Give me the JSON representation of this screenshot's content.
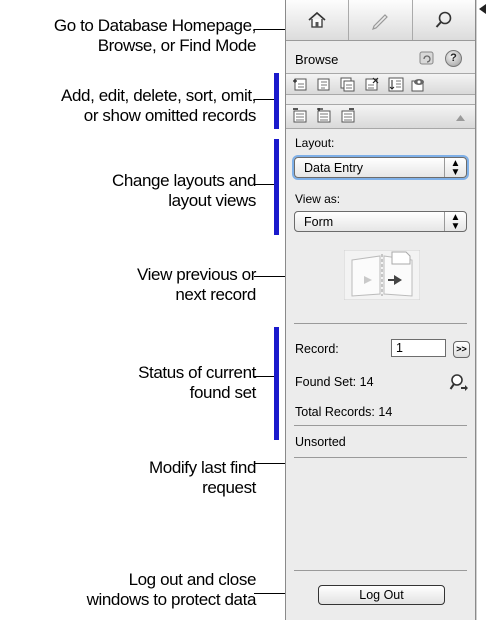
{
  "callouts": {
    "modes": [
      "Go to Database Homepage,",
      "Browse, or Find Mode"
    ],
    "records": [
      "Add, edit, delete, sort, omit,",
      "or show omitted records"
    ],
    "layouts": [
      "Change layouts and",
      "layout views"
    ],
    "navigate": [
      "View previous or",
      "next record"
    ],
    "status": [
      "Status of current",
      "found set"
    ],
    "modify": [
      "Modify last find",
      "request"
    ],
    "logout": [
      "Log out and close",
      "windows to protect data"
    ]
  },
  "panel": {
    "mode_header": "Browse",
    "help_glyph": "?",
    "layout_label": "Layout:",
    "layout_value": "Data Entry",
    "view_label": "View as:",
    "view_value": "Form",
    "record_label": "Record:",
    "record_value": "1",
    "next_glyph": ">>",
    "found_set": "Found Set: 14",
    "total_records": "Total Records: 14",
    "sort_state": "Unsorted",
    "logout_label": "Log Out"
  },
  "colors": {
    "bracket": "#1a1acc",
    "panel_bg": "#ececec",
    "focus_ring": "#7fb0e8"
  }
}
